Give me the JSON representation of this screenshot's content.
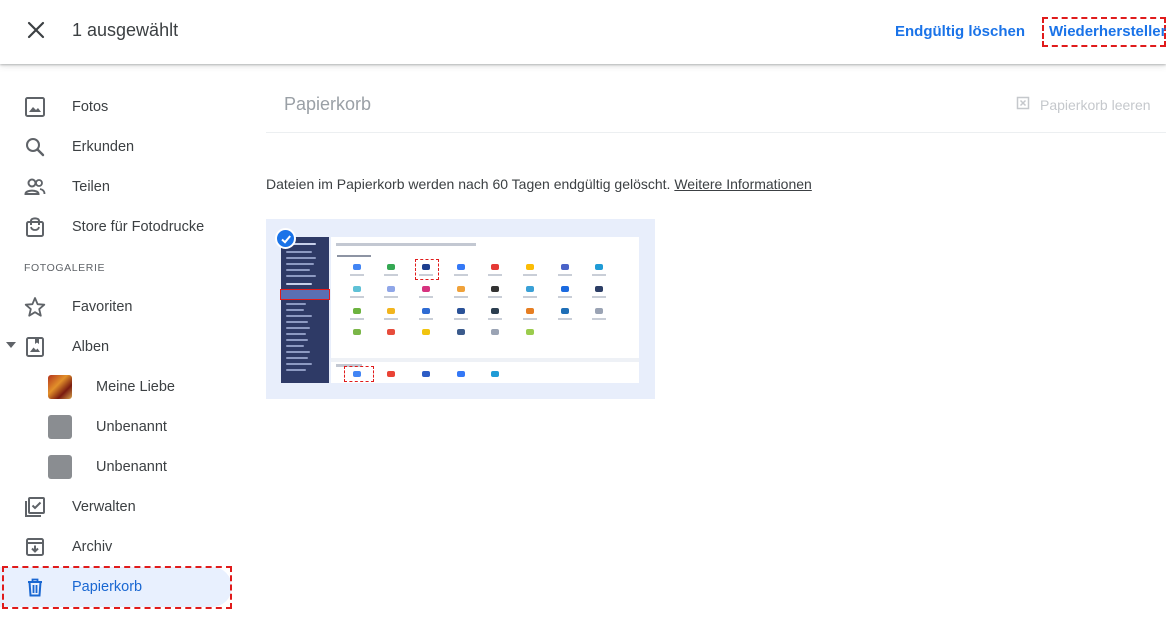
{
  "topbar": {
    "selection_count": "1 ausgewählt",
    "delete_label": "Endgültig löschen",
    "restore_label": "Wiederherstellen"
  },
  "sidebar": {
    "items": [
      {
        "label": "Fotos",
        "icon": "photo-icon"
      },
      {
        "label": "Erkunden",
        "icon": "search-icon"
      },
      {
        "label": "Teilen",
        "icon": "people-icon"
      },
      {
        "label": "Store für Fotodrucke",
        "icon": "shopping-bag-icon"
      }
    ],
    "section_label": "FOTOGALERIE",
    "library": [
      {
        "label": "Favoriten",
        "icon": "star-icon"
      },
      {
        "label": "Alben",
        "icon": "album-icon"
      }
    ],
    "albums": [
      {
        "label": "Meine Liebe"
      },
      {
        "label": "Unbenannt"
      },
      {
        "label": "Unbenannt"
      }
    ],
    "tools": [
      {
        "label": "Verwalten",
        "icon": "checklist-icon"
      },
      {
        "label": "Archiv",
        "icon": "archive-icon"
      },
      {
        "label": "Papierkorb",
        "icon": "trash-icon",
        "active": true
      }
    ]
  },
  "main": {
    "title": "Papierkorb",
    "empty_trash_label": "Papierkorb leeren",
    "info_text": "Dateien im Papierkorb werden nach 60 Tagen endgültig gelöscht.",
    "info_link": "Weitere Informationen"
  },
  "colors": {
    "accent": "#1a73e8",
    "active_bg": "#e8f0fe",
    "highlight_dashes": "#e01b1b"
  }
}
